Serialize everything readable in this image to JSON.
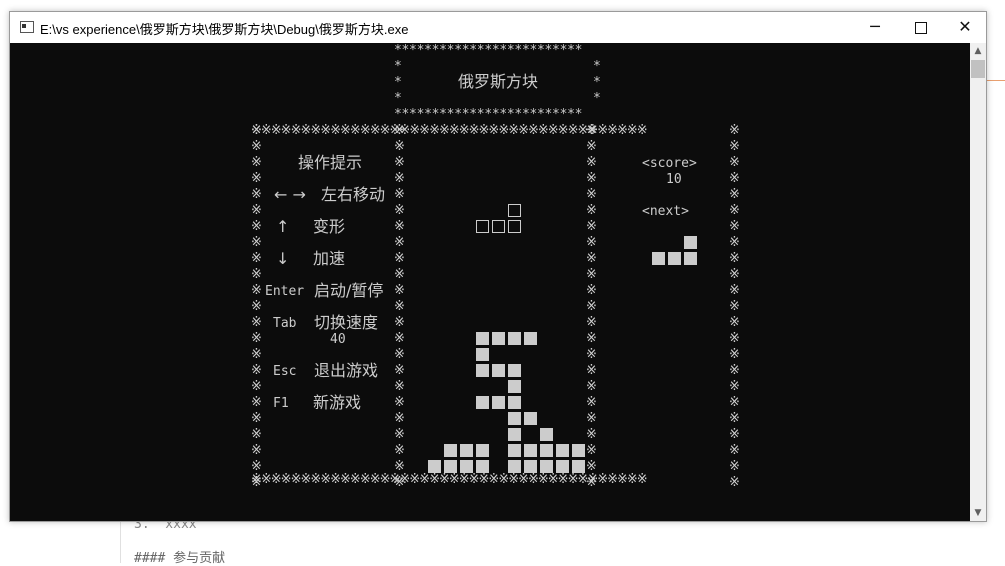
{
  "window": {
    "title": "E:\\vs experience\\俄罗斯方块\\俄罗斯方块\\Debug\\俄罗斯方块.exe",
    "minimize_glyph": "─",
    "close_glyph": "✕"
  },
  "background_doc": {
    "line1": "3.  xxxx",
    "line2": "#### 参与贡献"
  },
  "game": {
    "title": "俄罗斯方块",
    "header_border": "*************************",
    "border_char": "※"
  },
  "controls": {
    "heading": "操作提示",
    "items": [
      {
        "key": "← →",
        "label": "左右移动"
      },
      {
        "key": "↑",
        "label": "变形"
      },
      {
        "key": "↓",
        "label": "加速"
      },
      {
        "key": "Enter",
        "label": "启动/暂停"
      },
      {
        "key": "Tab",
        "label": "切换速度"
      },
      {
        "key": "Esc",
        "label": "退出游戏"
      },
      {
        "key": "F1",
        "label": "新游戏"
      }
    ],
    "speed_value": "40"
  },
  "score": {
    "label": "<score>",
    "value": "10",
    "next_label": "<next>"
  },
  "board": {
    "falling_piece": "L",
    "next_piece": "L"
  },
  "scroll": {
    "up_glyph": "▲",
    "down_glyph": "▼"
  }
}
